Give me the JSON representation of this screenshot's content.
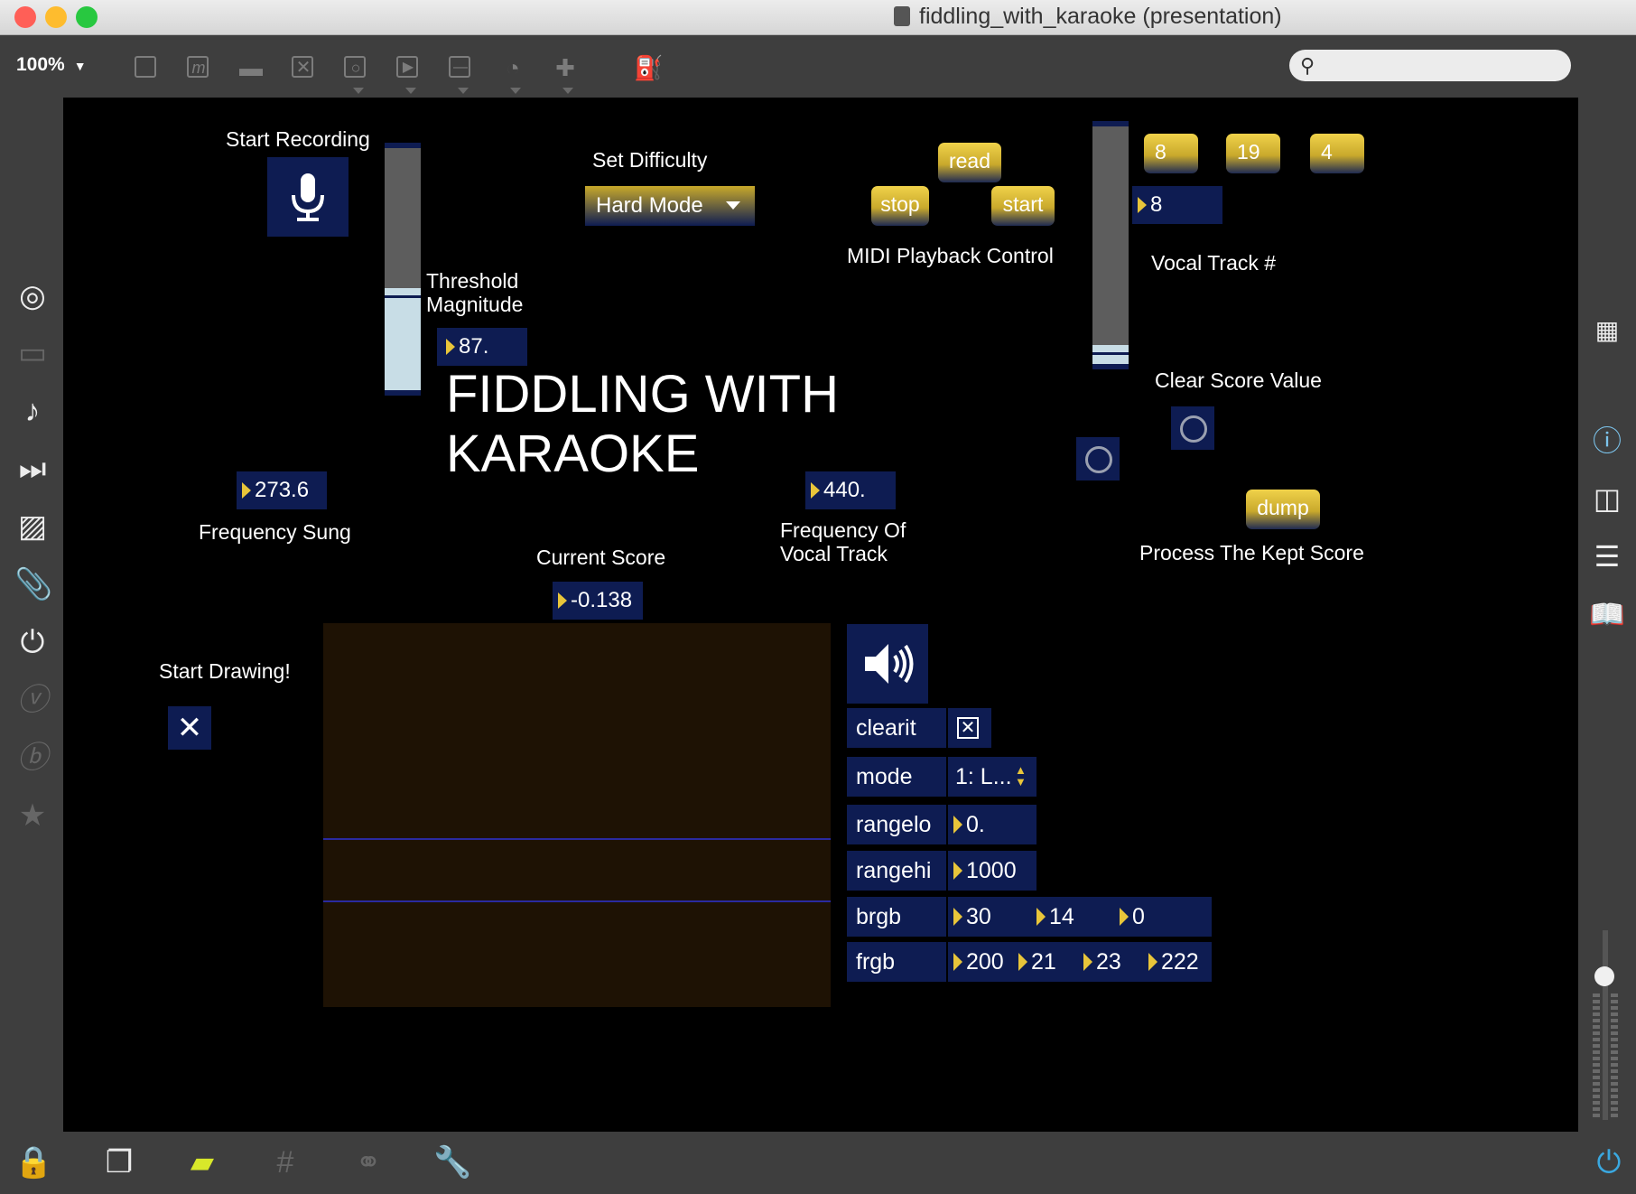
{
  "window": {
    "title": "fiddling_with_karaoke (presentation)",
    "traffic_lights": {
      "close": "#ff5f57",
      "minimize": "#febc2e",
      "zoom": "#28c840"
    }
  },
  "toolbar": {
    "zoom_label": "100%",
    "search_placeholder": ""
  },
  "patch": {
    "start_recording_label": "Start Recording",
    "threshold_label_line1": "Threshold",
    "threshold_label_line2": "Magnitude",
    "threshold_value": "87.",
    "set_difficulty_label": "Set Difficulty",
    "difficulty_value": "Hard Mode",
    "read_label": "read",
    "stop_label": "stop",
    "start_label": "start",
    "midi_playback_label": "MIDI Playback Control",
    "track_buttons": [
      "8",
      "19",
      "4"
    ],
    "vocal_track_value": "8",
    "vocal_track_label": "Vocal Track #",
    "clear_score_label": "Clear Score Value",
    "main_title_line1": "FIDDLING WITH",
    "main_title_line2": "KARAOKE",
    "frequency_sung_value": "273.6",
    "frequency_sung_label": "Frequency Sung",
    "vocal_frequency_value": "440.",
    "vocal_frequency_label_line1": "Frequency Of",
    "vocal_frequency_label_line2": "Vocal Track",
    "dump_label": "dump",
    "process_score_label": "Process The Kept Score",
    "current_score_label": "Current Score",
    "current_score_value": "-0.138",
    "start_drawing_label": "Start Drawing!",
    "threshold_slider_level": 0.42,
    "vocal_track_slider_level": 0.08
  },
  "inspector": {
    "rows": [
      {
        "name": "clearit",
        "values": []
      },
      {
        "name": "mode",
        "values": [
          "1: L..."
        ]
      },
      {
        "name": "rangelo",
        "values": [
          "0."
        ]
      },
      {
        "name": "rangehi",
        "values": [
          "1000"
        ]
      },
      {
        "name": "brgb",
        "values": [
          "30",
          "14",
          "0"
        ]
      },
      {
        "name": "frgb",
        "values": [
          "200",
          "21",
          "23",
          "222"
        ]
      }
    ]
  },
  "colors": {
    "canvas_bg": "#000000",
    "object_bg": "#0e1c52",
    "accent_yellow": "#e8c53a",
    "lcd_bg": "#1e1204"
  }
}
